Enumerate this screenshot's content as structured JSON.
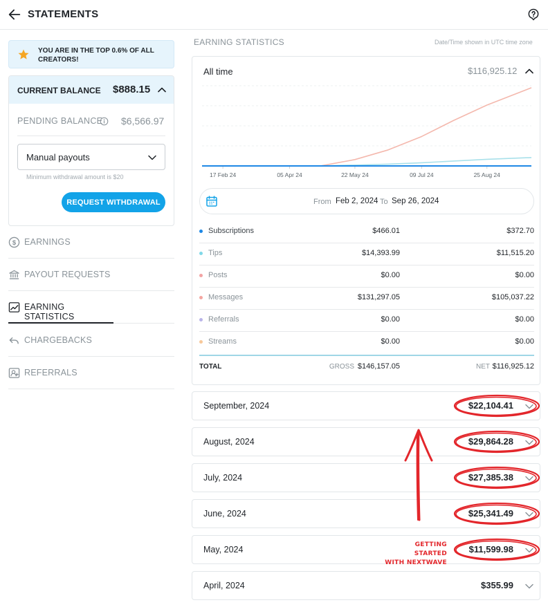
{
  "header": {
    "title": "STATEMENTS"
  },
  "banner": {
    "text": "YOU ARE IN THE TOP 0.6% OF ALL CREATORS!"
  },
  "balance": {
    "current_label": "CURRENT BALANCE",
    "current_value": "$888.15",
    "pending_label": "PENDING BALANCE",
    "pending_value": "$6,566.97",
    "payout_mode": "Manual payouts",
    "min_withdrawal": "Minimum withdrawal amount is $20",
    "withdraw_label": "REQUEST WITHDRAWAL"
  },
  "nav": [
    {
      "label": "EARNINGS",
      "icon": "dollar-circle-icon"
    },
    {
      "label": "PAYOUT REQUESTS",
      "icon": "bank-icon"
    },
    {
      "label": "EARNING STATISTICS",
      "icon": "trend-chart-icon",
      "active": true
    },
    {
      "label": "CHARGEBACKS",
      "icon": "undo-icon"
    },
    {
      "label": "REFERRALS",
      "icon": "referral-icon"
    }
  ],
  "stats": {
    "section_title": "EARNING STATISTICS",
    "timezone_note": "Date/Time shown in UTC time zone",
    "range_label": "All time",
    "range_total": "$116,925.12",
    "from_label": "From",
    "from_date": "Feb 2, 2024",
    "to_label": "To",
    "to_date": "Sep 26, 2024",
    "rows": [
      {
        "name": "Subscriptions",
        "gross": "$466.01",
        "net": "$372.70",
        "color": "#1e88e5"
      },
      {
        "name": "Tips",
        "gross": "$14,393.99",
        "net": "$11,515.20",
        "color": "#80d8e8"
      },
      {
        "name": "Posts",
        "gross": "$0.00",
        "net": "$0.00",
        "color": "#f2a3a3"
      },
      {
        "name": "Messages",
        "gross": "$131,297.05",
        "net": "$105,037.22",
        "color": "#f4a6a0"
      },
      {
        "name": "Referrals",
        "gross": "$0.00",
        "net": "$0.00",
        "color": "#b9b4e8"
      },
      {
        "name": "Streams",
        "gross": "$0.00",
        "net": "$0.00",
        "color": "#f7c89a"
      }
    ],
    "total_label": "TOTAL",
    "gross_label": "GROSS",
    "gross_total": "$146,157.05",
    "net_label": "NET",
    "net_total": "$116,925.12"
  },
  "chart_data": {
    "type": "line",
    "x_tick_labels": [
      "17 Feb 24",
      "05 Apr 24",
      "22 May 24",
      "09 Jul 24",
      "25 Aug 24"
    ],
    "x": [
      "2024-02-02",
      "2024-02-17",
      "2024-03-10",
      "2024-04-05",
      "2024-04-28",
      "2024-05-22",
      "2024-06-15",
      "2024-07-09",
      "2024-08-01",
      "2024-08-25",
      "2024-09-26"
    ],
    "series": [
      {
        "color": "#f4b8ad",
        "values": [
          0,
          0,
          0,
          0,
          300,
          9500,
          24000,
          44000,
          68000,
          91000,
          117000
        ]
      },
      {
        "color": "#a8e0ea",
        "values": [
          0,
          0,
          0,
          0,
          50,
          1300,
          2700,
          4700,
          7300,
          9900,
          12500
        ]
      },
      {
        "color": "#1e88e5",
        "values": [
          0,
          0,
          0,
          0,
          0,
          0,
          0,
          0,
          0,
          0,
          0
        ]
      }
    ],
    "ylim": [
      0,
      120000
    ],
    "grid": true
  },
  "months": [
    {
      "label": "September, 2024",
      "amount": "$22,104.41",
      "circled": true
    },
    {
      "label": "August, 2024",
      "amount": "$29,864.28",
      "circled": true
    },
    {
      "label": "July, 2024",
      "amount": "$27,385.38",
      "circled": true
    },
    {
      "label": "June, 2024",
      "amount": "$25,341.49",
      "circled": true
    },
    {
      "label": "May, 2024",
      "amount": "$11,599.98",
      "circled": true
    },
    {
      "label": "April, 2024",
      "amount": "$355.99",
      "circled": false
    }
  ],
  "annotation": {
    "line1": "GETTING STARTED",
    "line2": "WITH NEXTWAVE",
    "color": "#e3262b"
  }
}
